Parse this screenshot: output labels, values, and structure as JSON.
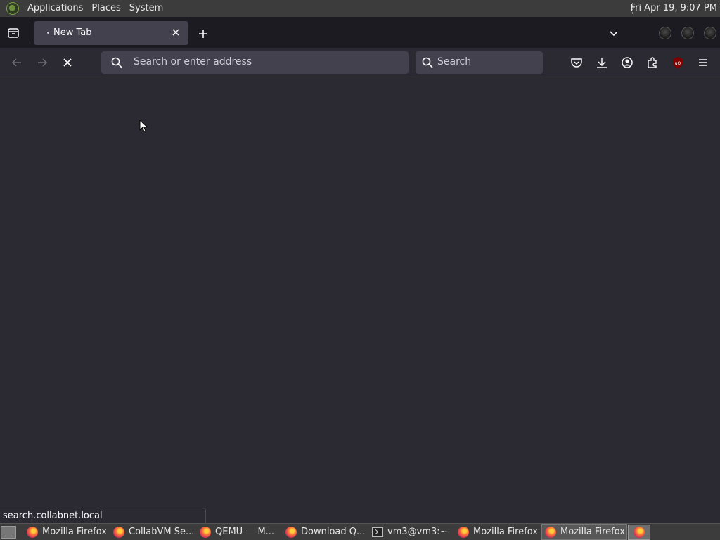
{
  "top_panel": {
    "menus": [
      "Applications",
      "Places",
      "System"
    ],
    "clock": "Fri Apr 19,  9:07 PM"
  },
  "tabs": [
    {
      "title": "New Tab",
      "active": true
    }
  ],
  "navbar": {
    "url_placeholder": "Search or enter address",
    "search_placeholder": "Search"
  },
  "status_text": "search.collabnet.local",
  "taskbar": {
    "tasks": [
      {
        "label": "Mozilla Firefox",
        "icon": "firefox-icon"
      },
      {
        "label": "CollabVM Se...",
        "icon": "firefox-icon"
      },
      {
        "label": "QEMU — M...",
        "icon": "firefox-icon"
      },
      {
        "label": "Download Q...",
        "icon": "firefox-icon"
      },
      {
        "label": "vm3@vm3:~",
        "icon": "terminal-icon"
      },
      {
        "label": "Mozilla Firefox",
        "icon": "firefox-icon"
      },
      {
        "label": "Mozilla Firefox",
        "icon": "firefox-icon",
        "active": true
      }
    ]
  },
  "colors": {
    "panel": "#3c3c3c",
    "tabstrip": "#1c1b22",
    "toolbar": "#2b2a33",
    "field": "#42414d",
    "ublock": "#800000"
  }
}
